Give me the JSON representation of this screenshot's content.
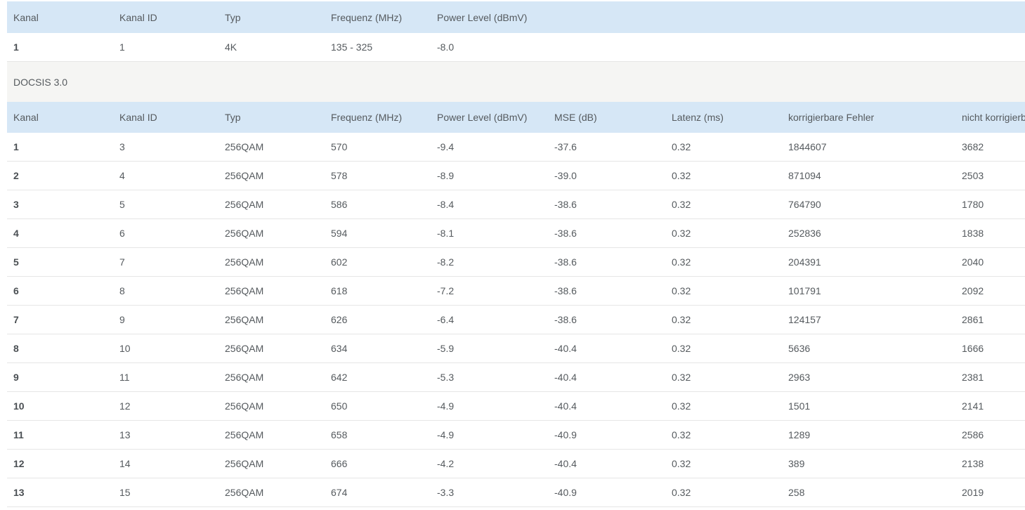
{
  "docsis31": {
    "headers": [
      "Kanal",
      "Kanal ID",
      "Typ",
      "Frequenz (MHz)",
      "Power Level (dBmV)"
    ],
    "rows": [
      [
        "1",
        "1",
        "4K",
        "135 - 325",
        "-8.0"
      ]
    ]
  },
  "docsis30": {
    "section_title": "DOCSIS 3.0",
    "headers": [
      "Kanal",
      "Kanal ID",
      "Typ",
      "Frequenz (MHz)",
      "Power Level (dBmV)",
      "MSE (dB)",
      "Latenz (ms)",
      "korrigierbare Fehler",
      "nicht korrigierbare Fehler"
    ],
    "rows": [
      [
        "1",
        "3",
        "256QAM",
        "570",
        "-9.4",
        "-37.6",
        "0.32",
        "1844607",
        "3682"
      ],
      [
        "2",
        "4",
        "256QAM",
        "578",
        "-8.9",
        "-39.0",
        "0.32",
        "871094",
        "2503"
      ],
      [
        "3",
        "5",
        "256QAM",
        "586",
        "-8.4",
        "-38.6",
        "0.32",
        "764790",
        "1780"
      ],
      [
        "4",
        "6",
        "256QAM",
        "594",
        "-8.1",
        "-38.6",
        "0.32",
        "252836",
        "1838"
      ],
      [
        "5",
        "7",
        "256QAM",
        "602",
        "-8.2",
        "-38.6",
        "0.32",
        "204391",
        "2040"
      ],
      [
        "6",
        "8",
        "256QAM",
        "618",
        "-7.2",
        "-38.6",
        "0.32",
        "101791",
        "2092"
      ],
      [
        "7",
        "9",
        "256QAM",
        "626",
        "-6.4",
        "-38.6",
        "0.32",
        "124157",
        "2861"
      ],
      [
        "8",
        "10",
        "256QAM",
        "634",
        "-5.9",
        "-40.4",
        "0.32",
        "5636",
        "1666"
      ],
      [
        "9",
        "11",
        "256QAM",
        "642",
        "-5.3",
        "-40.4",
        "0.32",
        "2963",
        "2381"
      ],
      [
        "10",
        "12",
        "256QAM",
        "650",
        "-4.9",
        "-40.4",
        "0.32",
        "1501",
        "2141"
      ],
      [
        "11",
        "13",
        "256QAM",
        "658",
        "-4.9",
        "-40.9",
        "0.32",
        "1289",
        "2586"
      ],
      [
        "12",
        "14",
        "256QAM",
        "666",
        "-4.2",
        "-40.4",
        "0.32",
        "389",
        "2138"
      ],
      [
        "13",
        "15",
        "256QAM",
        "674",
        "-3.3",
        "-40.9",
        "0.32",
        "258",
        "2019"
      ]
    ]
  }
}
